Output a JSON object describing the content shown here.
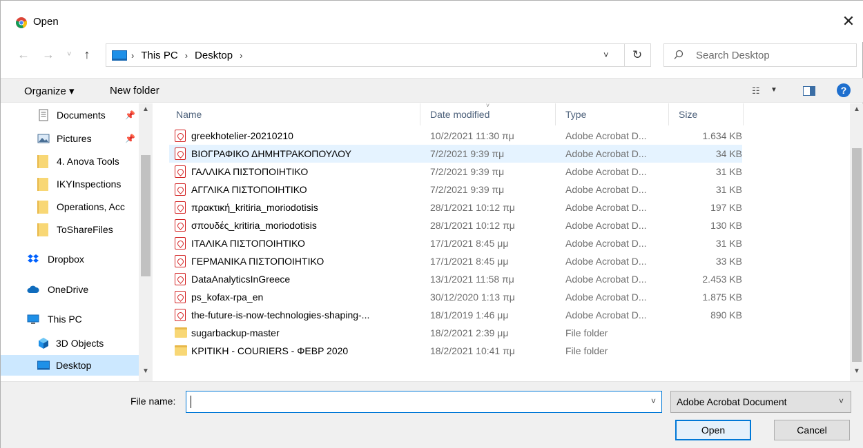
{
  "title": "Open",
  "address": {
    "crumbs": [
      "This PC",
      "Desktop"
    ]
  },
  "search": {
    "placeholder": "Search Desktop"
  },
  "toolbar": {
    "organize_label": "Organize ▾",
    "new_folder_label": "New folder",
    "help_label": "?"
  },
  "sidebar": {
    "items": [
      {
        "label": "Documents",
        "icon": "documents-icon",
        "pinned": true
      },
      {
        "label": "Pictures",
        "icon": "pictures-icon",
        "pinned": true
      },
      {
        "label": "4. Anova Tools",
        "icon": "folder-icon"
      },
      {
        "label": "IKYInspections",
        "icon": "folder-icon"
      },
      {
        "label": "Operations, Acc",
        "icon": "folder-icon"
      },
      {
        "label": "ToShareFiles",
        "icon": "folder-icon"
      },
      {
        "label": "Dropbox",
        "icon": "dropbox-icon"
      },
      {
        "label": "OneDrive",
        "icon": "onedrive-icon"
      },
      {
        "label": "This PC",
        "icon": "pc-icon"
      },
      {
        "label": "3D Objects",
        "icon": "3d-objects-icon"
      },
      {
        "label": "Desktop",
        "icon": "desktop-icon",
        "selected": true
      }
    ]
  },
  "columns": {
    "name": "Name",
    "date": "Date modified",
    "type": "Type",
    "size": "Size"
  },
  "files": [
    {
      "name": "greekhotelier-20210210",
      "date": "10/2/2021 11:30 πμ",
      "type": "Adobe Acrobat D...",
      "size": "1.634 KB",
      "kind": "pdf"
    },
    {
      "name": "ΒΙΟΓΡΑΦΙΚΟ ΔΗΜΗΤΡΑΚΟΠΟΥΛΟΥ",
      "date": "7/2/2021 9:39 πμ",
      "type": "Adobe Acrobat D...",
      "size": "34 KB",
      "kind": "pdf",
      "selected": true
    },
    {
      "name": "ΓΑΛΛΙΚΑ ΠΙΣΤΟΠΟΙΗΤΙΚΟ",
      "date": "7/2/2021 9:39 πμ",
      "type": "Adobe Acrobat D...",
      "size": "31 KB",
      "kind": "pdf"
    },
    {
      "name": "ΑΓΓΛΙΚΑ ΠΙΣΤΟΠΟΙΗΤΙΚΟ",
      "date": "7/2/2021 9:39 πμ",
      "type": "Adobe Acrobat D...",
      "size": "31 KB",
      "kind": "pdf"
    },
    {
      "name": "πρακτική_kritiria_moriodotisis",
      "date": "28/1/2021 10:12 πμ",
      "type": "Adobe Acrobat D...",
      "size": "197 KB",
      "kind": "pdf"
    },
    {
      "name": "σπουδές_kritiria_moriodotisis",
      "date": "28/1/2021 10:12 πμ",
      "type": "Adobe Acrobat D...",
      "size": "130 KB",
      "kind": "pdf"
    },
    {
      "name": "ΙΤΑΛΙΚΑ ΠΙΣΤΟΠΟΙΗΤΙΚΟ",
      "date": "17/1/2021 8:45 μμ",
      "type": "Adobe Acrobat D...",
      "size": "31 KB",
      "kind": "pdf"
    },
    {
      "name": "ΓΕΡΜΑΝΙΚΑ ΠΙΣΤΟΠΟΙΗΤΙΚΟ",
      "date": "17/1/2021 8:45 μμ",
      "type": "Adobe Acrobat D...",
      "size": "33 KB",
      "kind": "pdf"
    },
    {
      "name": "DataAnalyticsInGreece",
      "date": "13/1/2021 11:58 πμ",
      "type": "Adobe Acrobat D...",
      "size": "2.453 KB",
      "kind": "pdf"
    },
    {
      "name": "ps_kofax-rpa_en",
      "date": "30/12/2020 1:13 πμ",
      "type": "Adobe Acrobat D...",
      "size": "1.875 KB",
      "kind": "pdf"
    },
    {
      "name": "the-future-is-now-technologies-shaping-...",
      "date": "18/1/2019 1:46 μμ",
      "type": "Adobe Acrobat D...",
      "size": "890 KB",
      "kind": "pdf"
    },
    {
      "name": "sugarbackup-master",
      "date": "18/2/2021 2:39 μμ",
      "type": "File folder",
      "size": "",
      "kind": "folder"
    },
    {
      "name": "ΚΡΙΤΙΚΗ - COURIERS - ΦΕΒΡ 2020",
      "date": "18/2/2021 10:41 πμ",
      "type": "File folder",
      "size": "",
      "kind": "folder"
    }
  ],
  "footer": {
    "file_name_label": "File name:",
    "file_name_value": "",
    "file_type": "Adobe Acrobat Document",
    "open_label": "Open",
    "cancel_label": "Cancel"
  }
}
